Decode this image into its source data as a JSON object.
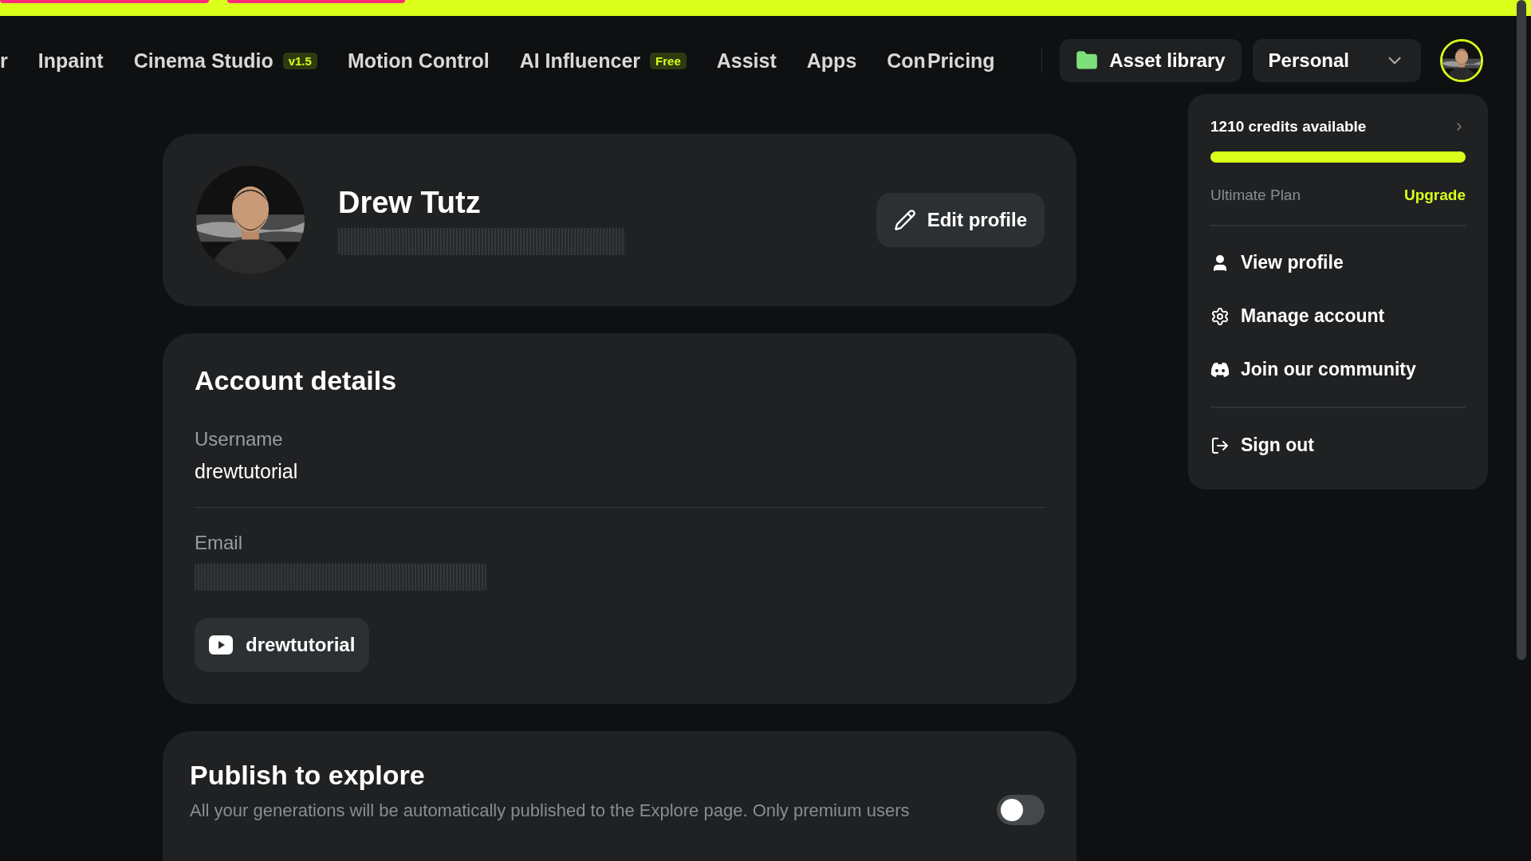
{
  "nav": {
    "items": [
      {
        "label": "r"
      },
      {
        "label": "Inpaint"
      },
      {
        "label": "Cinema Studio",
        "badge": "v1.5"
      },
      {
        "label": "Motion Control"
      },
      {
        "label": "AI Influencer",
        "badge": "Free"
      },
      {
        "label": "Assist"
      },
      {
        "label": "Apps"
      },
      {
        "label": "Con"
      },
      {
        "label": "Pricing"
      }
    ],
    "asset_button": "Asset library",
    "workspace": "Personal"
  },
  "profile": {
    "name": "Drew Tutz",
    "edit_button": "Edit profile"
  },
  "account": {
    "title": "Account details",
    "username_label": "Username",
    "username": "drewtutorial",
    "email_label": "Email",
    "channel": "drewtutorial"
  },
  "publish": {
    "title": "Publish to explore",
    "description": "All your generations will be automatically published to the Explore page. Only premium users",
    "on": false
  },
  "menu": {
    "credits": "1210 credits available",
    "level": 1,
    "plan": "Ultimate Plan",
    "upgrade": "Upgrade",
    "items": [
      {
        "kind": "profile",
        "label": "View profile"
      },
      {
        "kind": "settings",
        "label": "Manage account"
      },
      {
        "kind": "community",
        "label": "Join our community"
      },
      {
        "kind": "signout",
        "label": "Sign out"
      }
    ]
  }
}
